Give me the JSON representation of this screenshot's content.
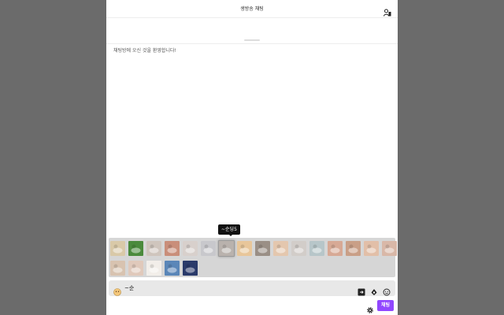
{
  "header": {
    "title": "생방송 채팅",
    "users_icon": "users-icon"
  },
  "messages": {
    "welcome": "채팅방에 오신 것을 환영합니다!"
  },
  "emote_panel": {
    "tooltip": "~순딩5",
    "emotes": [
      {
        "name": "emote-1",
        "color": "#d9c9a8"
      },
      {
        "name": "emote-2",
        "color": "#4a8a3c"
      },
      {
        "name": "emote-3",
        "color": "#cfc5bd"
      },
      {
        "name": "emote-4",
        "color": "#c98e7a"
      },
      {
        "name": "emote-5",
        "color": "#d8d0cc"
      },
      {
        "name": "emote-6",
        "color": "#c8c8cc"
      },
      {
        "name": "emote-7",
        "color": "#b9b2ad"
      },
      {
        "name": "emote-8",
        "color": "#e8c69a"
      },
      {
        "name": "emote-9",
        "color": "#9a8f86"
      },
      {
        "name": "emote-10",
        "color": "#e4c7ae"
      },
      {
        "name": "emote-11",
        "color": "#d2cdc9"
      },
      {
        "name": "emote-12",
        "color": "#b7c6c9"
      },
      {
        "name": "emote-13",
        "color": "#d7a995"
      },
      {
        "name": "emote-14",
        "color": "#c99f87"
      },
      {
        "name": "emote-15",
        "color": "#e2bfa8"
      },
      {
        "name": "emote-16",
        "color": "#d9b8a8"
      },
      {
        "name": "emote-17",
        "color": "#d8c3b0"
      },
      {
        "name": "emote-18",
        "color": "#e0c9bb"
      },
      {
        "name": "emote-19",
        "color": "#f2eee9"
      },
      {
        "name": "emote-20",
        "color": "#5a86b8"
      },
      {
        "name": "emote-21",
        "color": "#2a3a6a"
      }
    ]
  },
  "input": {
    "text": "~순",
    "emote_icon": "emote-icon",
    "icons": [
      "enter-icon",
      "drop-icon",
      "smiley-icon"
    ]
  },
  "footer": {
    "settings_icon": "gear-icon",
    "chat_label": "채팅"
  },
  "colors": {
    "backdrop": "#6b6b6b",
    "accent": "#9147ff",
    "tooltip_bg": "#111111"
  }
}
